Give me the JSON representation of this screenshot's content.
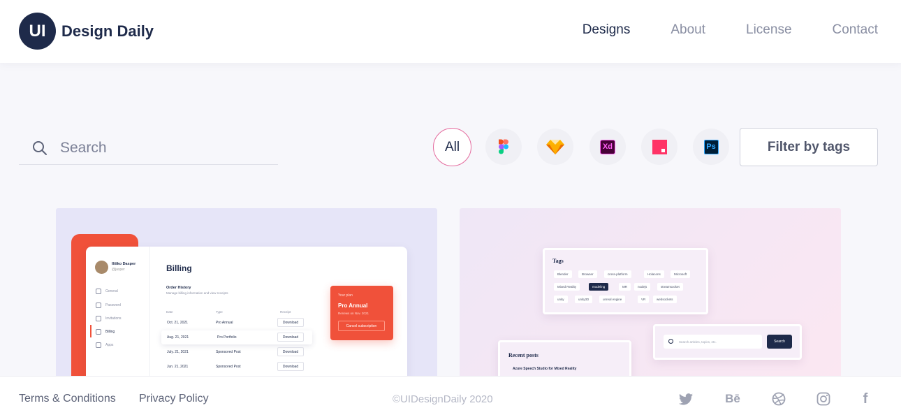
{
  "header": {
    "logo_mark": "UI",
    "logo_text": "Design Daily",
    "nav": [
      "Designs",
      "About",
      "License",
      "Contact"
    ]
  },
  "search": {
    "placeholder": "Search"
  },
  "filters": {
    "all_label": "All",
    "tools": [
      "figma-icon",
      "sketch-icon",
      "xd-icon",
      "invision-icon",
      "photoshop-icon"
    ],
    "xd_text": "Xd",
    "ps_text": "Ps",
    "tags_button": "Filter by tags"
  },
  "card_left": {
    "user_name": "Iliško Dasper",
    "user_handle": "@jasper",
    "side_items": [
      "General",
      "Password",
      "Invitations",
      "Billing",
      "Apps"
    ],
    "title": "Billing",
    "order_title": "Order History",
    "order_sub": "Manage billing information and view receipts",
    "columns": [
      "Date",
      "Type",
      "Receipt"
    ],
    "rows": [
      {
        "date": "Oct. 21, 2021",
        "type": "Pro Annual",
        "receipt": "Download"
      },
      {
        "date": "Aug. 21, 2021",
        "type": "Pro Portfolio",
        "receipt": "Download"
      },
      {
        "date": "July. 21, 2021",
        "type": "Sponsored Post",
        "receipt": "Download"
      },
      {
        "date": "Jun. 21, 2021",
        "type": "Sponsored Post",
        "receipt": "Download"
      }
    ],
    "plan_label": "Your plan",
    "plan_name": "Pro Annual",
    "plan_renew": "Renews on Nov. 2021",
    "plan_cancel": "Cancel subscription"
  },
  "card_right": {
    "tags_title": "Tags",
    "tags": [
      "Blender",
      "Browser",
      "cross-platform",
      "Holacons",
      "Microsoft",
      "Mixed Reality",
      "modeling",
      "MR",
      "nodejs",
      "streamsocket",
      "unity",
      "unity3D",
      "unreal engine",
      "VR",
      "websockets"
    ],
    "search_placeholder": "Search articles, topics, etc.",
    "search_button": "Search",
    "recent_title": "Recent posts",
    "recent_item": "Azure Speech Studio for Mixed Reality"
  },
  "footer": {
    "links": [
      "Terms & Conditions",
      "Privacy Policy"
    ],
    "copyright": "©UIDesignDaily 2020",
    "social": [
      "twitter-icon",
      "behance-icon",
      "dribbble-icon",
      "instagram-icon",
      "facebook-icon"
    ],
    "behance_text": "Bē",
    "facebook_text": "f"
  }
}
